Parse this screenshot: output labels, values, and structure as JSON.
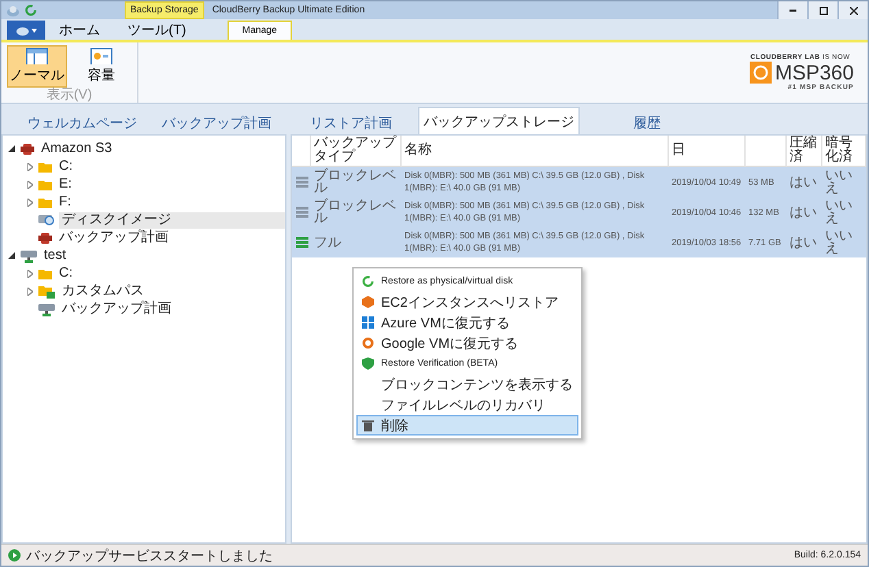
{
  "window": {
    "title": "CloudBerry Backup Ultimate Edition",
    "context_label": "Backup Storage"
  },
  "ribbon_tabs": [
    {
      "label": "ホーム",
      "selected": false
    },
    {
      "label": "ツール(T)",
      "selected": false
    },
    {
      "label": "Manage",
      "selected": true
    }
  ],
  "ribbon": {
    "buttons": [
      {
        "label": "ノーマル",
        "selected": true
      },
      {
        "label": "容量",
        "selected": false
      }
    ],
    "group_label": "表示(V)"
  },
  "logo": {
    "tagline_top": "CLOUDBERRY LAB",
    "tagline_now": "IS NOW",
    "name": "MSP360",
    "tagline_bottom": "#1 MSP BACKUP"
  },
  "tabs": [
    {
      "label": "ウェルカムページ",
      "selected": false
    },
    {
      "label": "バックアップ計画",
      "selected": false
    },
    {
      "label": "リストア計画",
      "selected": false
    },
    {
      "label": "バックアップストレージ",
      "selected": true
    },
    {
      "label": "履歴",
      "selected": false
    }
  ],
  "tree": [
    {
      "label": "Amazon S3",
      "kind": "cloud",
      "expanded": true,
      "selected": false,
      "children": [
        {
          "label": "C:",
          "kind": "folder",
          "expanded": false,
          "selected": false
        },
        {
          "label": "E:",
          "kind": "folder",
          "expanded": false,
          "selected": false
        },
        {
          "label": "F:",
          "kind": "folder",
          "expanded": false,
          "selected": false
        },
        {
          "label": "ディスクイメージ",
          "kind": "disk",
          "selected": true
        },
        {
          "label": "バックアップ計画",
          "kind": "plan",
          "selected": false
        }
      ]
    },
    {
      "label": "test",
      "kind": "computer",
      "expanded": true,
      "selected": false,
      "children": [
        {
          "label": "C:",
          "kind": "folder",
          "expanded": false,
          "selected": false
        },
        {
          "label": "カスタムパス",
          "kind": "custom",
          "expanded": false,
          "selected": false
        },
        {
          "label": "バックアップ計画",
          "kind": "computer",
          "selected": false
        }
      ]
    }
  ],
  "table": {
    "columns": [
      "バックアップタイプ",
      "名称",
      "日",
      "圧縮済",
      "暗号化済"
    ],
    "rows": [
      {
        "kind": "block",
        "selected": true,
        "type": "ブロックレベル",
        "name": "Disk 0(MBR): 500 MB (361 MB) C:\\ 39.5 GB (12.0 GB) , Disk 1(MBR): E:\\ 40.0 GB (91 MB)",
        "date": "2019/10/04 10:49",
        "size": "53 MB",
        "compressed": "はい",
        "encrypted": "いいえ"
      },
      {
        "kind": "block",
        "selected": true,
        "type": "ブロックレベル",
        "name": "Disk 0(MBR): 500 MB (361 MB) C:\\ 39.5 GB (12.0 GB) , Disk 1(MBR): E:\\ 40.0 GB (91 MB)",
        "date": "2019/10/04 10:46",
        "size": "132 MB",
        "compressed": "はい",
        "encrypted": "いいえ"
      },
      {
        "kind": "full",
        "selected": true,
        "type": "フル",
        "name": "Disk 0(MBR): 500 MB (361 MB) C:\\ 39.5 GB (12.0 GB) , Disk 1(MBR): E:\\ 40.0 GB (91 MB)",
        "date": "2019/10/03 18:56",
        "size": "7.71 GB",
        "compressed": "はい",
        "encrypted": "いいえ"
      }
    ]
  },
  "context_menu": [
    {
      "label": "Restore as physical/virtual disk",
      "kind": "restore",
      "selected": false
    },
    {
      "label": "EC2インスタンスへリストア",
      "kind": "ec2",
      "selected": false
    },
    {
      "label": "Azure VMに復元する",
      "kind": "azure",
      "selected": false
    },
    {
      "label": "Google VMに復元する",
      "kind": "google",
      "selected": false
    },
    {
      "label": "Restore Verification (BETA)",
      "kind": "verify",
      "selected": false
    },
    {
      "label": "ブロックコンテンツを表示する",
      "kind": "plain",
      "selected": false
    },
    {
      "label": "ファイルレベルのリカバリ",
      "kind": "plain",
      "selected": false
    },
    {
      "label": "削除",
      "kind": "delete",
      "selected": true
    }
  ],
  "status_bar": {
    "message": "バックアップサービススタートしました",
    "build": "Build: 6.2.0.154"
  }
}
